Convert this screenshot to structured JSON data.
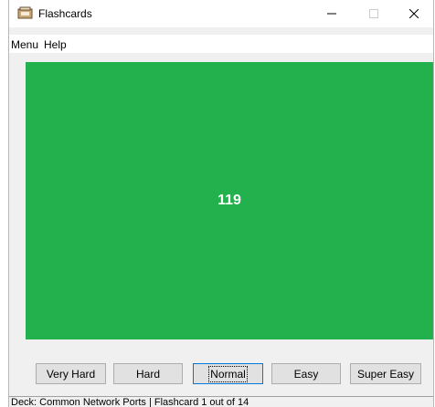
{
  "window": {
    "title": "Flashcards",
    "controls": {
      "minimize_icon": "minimize-icon",
      "maximize_icon": "maximize-icon",
      "close_icon": "close-icon"
    }
  },
  "menubar": {
    "items": [
      {
        "label": "Menu"
      },
      {
        "label": "Help"
      }
    ]
  },
  "card": {
    "text": "119",
    "background_color": "#23b14d",
    "text_color": "#ffffff"
  },
  "rating_buttons": [
    {
      "label": "Very Hard"
    },
    {
      "label": "Hard"
    },
    {
      "label": "Normal",
      "focused": true
    },
    {
      "label": "Easy"
    },
    {
      "label": "Super Easy"
    }
  ],
  "statusbar": {
    "text": "Deck: Common Network Ports | Flashcard 1 out of 14"
  }
}
